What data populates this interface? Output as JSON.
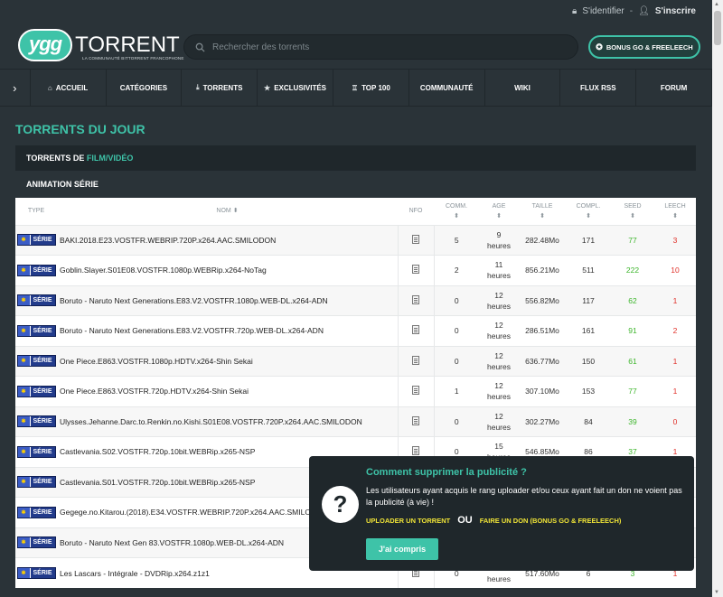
{
  "topbar": {
    "login": "S'identifier",
    "separator": "-",
    "register": "S'inscrire"
  },
  "header": {
    "logo_main": "ygg",
    "logo_torrent": "TORRENT",
    "logo_sub": "LA COMMUNAUTÉ BITTORRENT FRANCOPHONE",
    "search_placeholder": "Rechercher des torrents",
    "bonus_label": "BONUS GO & FREELEECH"
  },
  "nav": {
    "toggle": "›",
    "items": [
      {
        "label": "ACCUEIL",
        "icon": "⌂"
      },
      {
        "label": "CATÉGORIES",
        "icon": ""
      },
      {
        "label": "TORRENTS",
        "icon": "⤓"
      },
      {
        "label": "EXCLUSIVITÉS",
        "icon": "★"
      },
      {
        "label": "TOP 100",
        "icon": "♖"
      },
      {
        "label": "COMMUNAUTÉ",
        "icon": ""
      },
      {
        "label": "WIKI",
        "icon": ""
      },
      {
        "label": "FLUX RSS",
        "icon": ""
      },
      {
        "label": "FORUM",
        "icon": ""
      }
    ]
  },
  "main": {
    "title": "TORRENTS DU JOUR",
    "section_prefix": "TORRENTS DE ",
    "section_highlight": "FILM/VIDÉO",
    "subsection": "ANIMATION SÉRIE"
  },
  "table": {
    "headers": {
      "type": "TYPE",
      "name": "NOM ⬍",
      "nfo": "NFO",
      "comm": "COMM.",
      "age": "AGE",
      "size": "TAILLE",
      "compl": "COMPL.",
      "seed": "SEED",
      "leech": "LEECH",
      "sort": "⬍"
    },
    "badge_label": "SÉRIE",
    "rows": [
      {
        "name": "BAKI.2018.E23.VOSTFR.WEBRIP.720P.x264.AAC.SMILODON",
        "comm": "5",
        "age1": "9",
        "age2": "heures",
        "size": "282.48Mo",
        "compl": "171",
        "seed": "77",
        "leech": "3"
      },
      {
        "name": "Goblin.Slayer.S01E08.VOSTFR.1080p.WEBRip.x264-NoTag",
        "comm": "2",
        "age1": "11",
        "age2": "heures",
        "size": "856.21Mo",
        "compl": "511",
        "seed": "222",
        "leech": "10"
      },
      {
        "name": "Boruto - Naruto Next Generations.E83.V2.VOSTFR.1080p.WEB-DL.x264-ADN",
        "comm": "0",
        "age1": "12",
        "age2": "heures",
        "size": "556.82Mo",
        "compl": "117",
        "seed": "62",
        "leech": "1"
      },
      {
        "name": "Boruto - Naruto Next Generations.E83.V2.VOSTFR.720p.WEB-DL.x264-ADN",
        "comm": "0",
        "age1": "12",
        "age2": "heures",
        "size": "286.51Mo",
        "compl": "161",
        "seed": "91",
        "leech": "2"
      },
      {
        "name": "One Piece.E863.VOSTFR.1080p.HDTV.x264-Shin Sekai",
        "comm": "0",
        "age1": "12",
        "age2": "heures",
        "size": "636.77Mo",
        "compl": "150",
        "seed": "61",
        "leech": "1"
      },
      {
        "name": "One Piece.E863.VOSTFR.720p.HDTV.x264-Shin Sekai",
        "comm": "1",
        "age1": "12",
        "age2": "heures",
        "size": "307.10Mo",
        "compl": "153",
        "seed": "77",
        "leech": "1"
      },
      {
        "name": "Ulysses.Jehanne.Darc.to.Renkin.no.Kishi.S01E08.VOSTFR.720P.x264.AAC.SMILODON",
        "comm": "0",
        "age1": "12",
        "age2": "heures",
        "size": "302.27Mo",
        "compl": "84",
        "seed": "39",
        "leech": "0"
      },
      {
        "name": "Castlevania.S02.VOSTFR.720p.10bit.WEBRip.x265-NSP",
        "comm": "0",
        "age1": "15",
        "age2": "heures",
        "size": "546.85Mo",
        "compl": "86",
        "seed": "37",
        "leech": "1"
      },
      {
        "name": "Castlevania.S01.VOSTFR.720p.10bit.WEBRip.x265-NSP",
        "comm": "",
        "age1": "",
        "age2": "",
        "size": "",
        "compl": "",
        "seed": "",
        "leech": ""
      },
      {
        "name": "Gegege.no.Kitarou.(2018).E34.VOSTFR.WEBRIP.720P.x264.AAC.SMILODON",
        "comm": "",
        "age1": "",
        "age2": "",
        "size": "",
        "compl": "",
        "seed": "",
        "leech": ""
      },
      {
        "name": "Boruto - Naruto Next Gen 83.VOSTFR.1080p.WEB-DL.x264-ADN",
        "comm": "",
        "age1": "",
        "age2": "",
        "size": "",
        "compl": "",
        "seed": "",
        "leech": ""
      },
      {
        "name": "Les Lascars - Intégrale - DVDRip.x264.z1z1",
        "comm": "0",
        "age1": "18",
        "age2": "heures",
        "size": "517.60Mo",
        "compl": "6",
        "seed": "3",
        "leech": "1"
      }
    ]
  },
  "popup": {
    "icon": "?",
    "title": "Comment supprimer la publicité ?",
    "text": "Les utilisateurs ayant acquis le rang uploader et/ou ceux ayant fait un don ne voient pas la publicité (à vie) !",
    "link_uploader": "UPLOADER UN TORRENT",
    "or": "OU",
    "link_donate": "FAIRE UN DON (BONUS GO & FREELEECH)",
    "ok_button": "J'ai compris"
  },
  "colors": {
    "accent": "#3ec3a8",
    "seed": "#3cb52b",
    "leech": "#e0312a",
    "badge": "#223b8b"
  }
}
